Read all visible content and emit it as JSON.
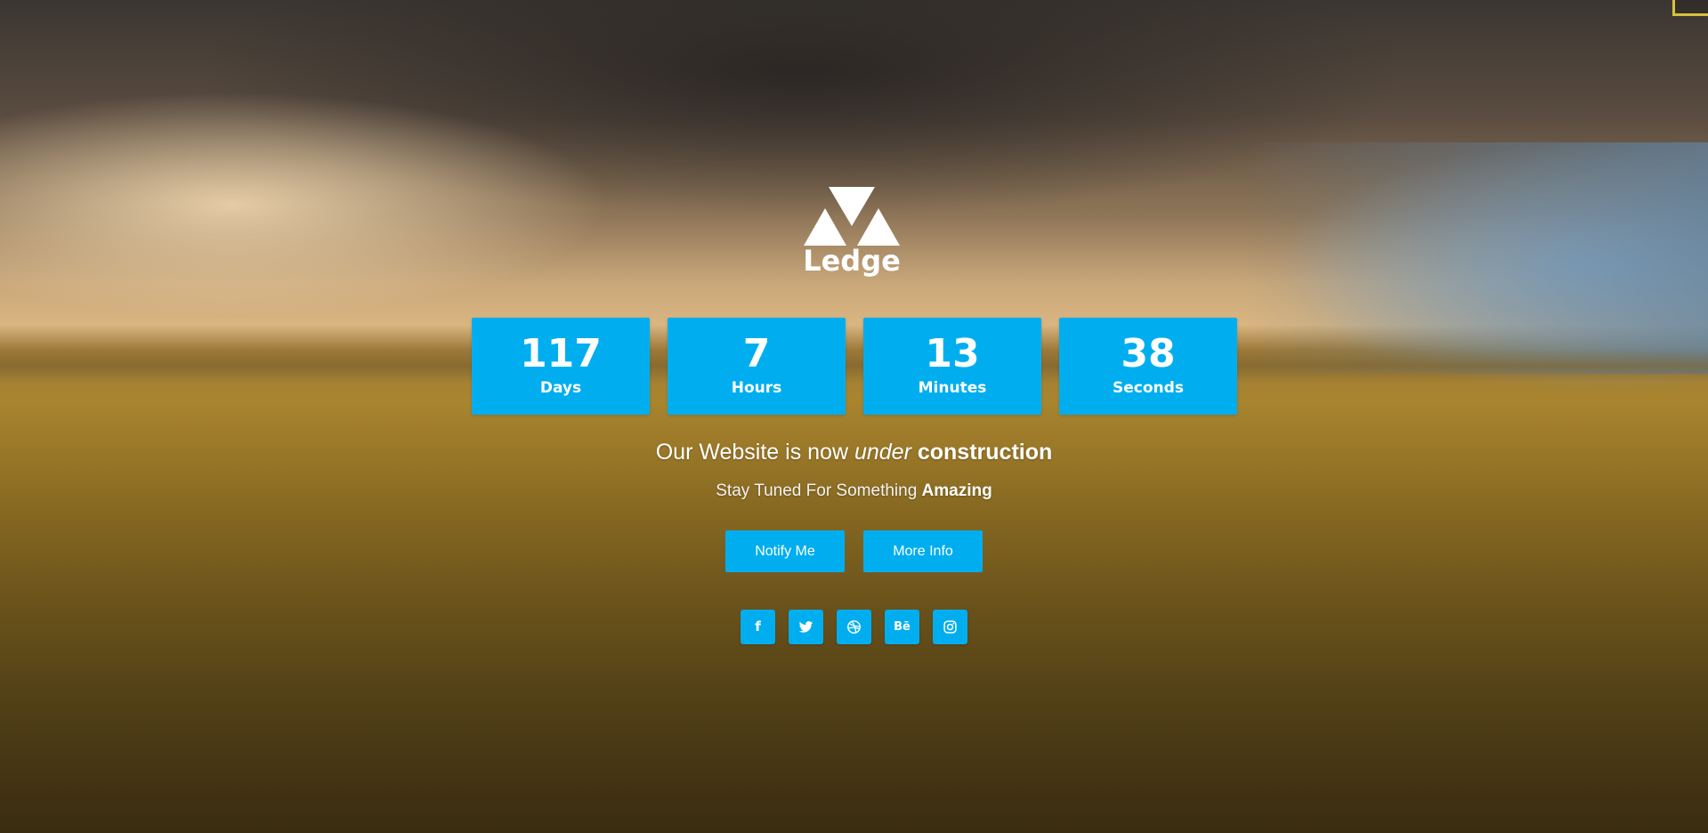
{
  "brand": {
    "name": "Ledge",
    "logo_icon": "triangles-logo-icon"
  },
  "countdown": {
    "days": {
      "value": "117",
      "label": "Days"
    },
    "hours": {
      "value": "7",
      "label": "Hours"
    },
    "minutes": {
      "value": "13",
      "label": "Minutes"
    },
    "seconds": {
      "value": "38",
      "label": "Seconds"
    }
  },
  "headline": {
    "part1": "Our Website is now ",
    "emphasis": "under",
    "space": " ",
    "strong": "construction"
  },
  "subline": {
    "part1": "Stay Tuned For Something ",
    "strong": "Amazing"
  },
  "buttons": {
    "notify": "Notify Me",
    "more_info": "More Info"
  },
  "social": [
    {
      "name": "facebook",
      "icon": "facebook-icon",
      "glyph": "f"
    },
    {
      "name": "twitter",
      "icon": "twitter-icon"
    },
    {
      "name": "dribbble",
      "icon": "dribbble-icon"
    },
    {
      "name": "behance",
      "icon": "behance-icon",
      "glyph": "Bē"
    },
    {
      "name": "instagram",
      "icon": "instagram-icon"
    }
  ],
  "colors": {
    "accent": "#00aeef",
    "text": "#ffffff"
  }
}
